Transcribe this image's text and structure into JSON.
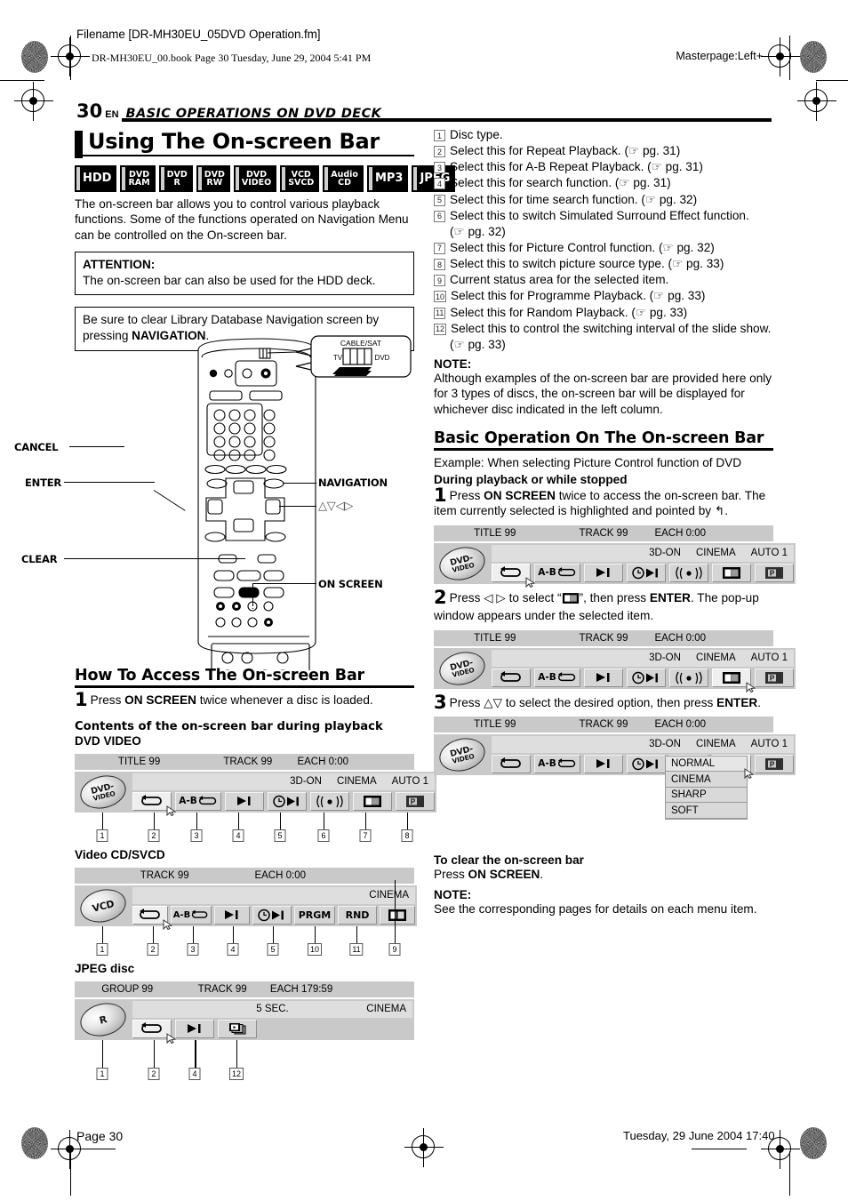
{
  "header": {
    "filename": "Filename [DR-MH30EU_05DVD Operation.fm]",
    "bookline": "DR-MH30EU_00.book  Page 30  Tuesday, June 29, 2004  5:41 PM",
    "masterpage": "Masterpage:Left+"
  },
  "runhead": {
    "page_number": "30",
    "lang": "EN",
    "section": "BASIC OPERATIONS ON DVD DECK"
  },
  "left": {
    "title": "Using The On-screen Bar",
    "badges": [
      {
        "name": "hdd-badge",
        "l1": "HDD",
        "l2": "",
        "single": true
      },
      {
        "name": "dvd-ram-badge",
        "l1": "DVD",
        "l2": "RAM",
        "single": false
      },
      {
        "name": "dvd-r-badge",
        "l1": "DVD",
        "l2": "R",
        "single": false
      },
      {
        "name": "dvd-rw-badge",
        "l1": "DVD",
        "l2": "RW",
        "single": false
      },
      {
        "name": "dvd-video-badge",
        "l1": "DVD",
        "l2": "VIDEO",
        "single": false
      },
      {
        "name": "vcd-svcd-badge",
        "l1": "VCD",
        "l2": "SVCD",
        "single": false
      },
      {
        "name": "audio-cd-badge",
        "l1": "Audio",
        "l2": "CD",
        "single": false
      },
      {
        "name": "mp3-badge",
        "l1": "MP3",
        "l2": "",
        "single": true
      },
      {
        "name": "jpeg-badge",
        "l1": "JPEG",
        "l2": "",
        "single": true
      }
    ],
    "intro": "The on-screen bar allows you to control various playback functions. Some of the functions operated on Navigation Menu can be controlled on the On-screen bar.",
    "attention_label": "ATTENTION:",
    "attention_text": "The on-screen bar can also be used for the HDD deck.",
    "navnote_pre": "Be sure to clear Library Database Navigation screen by pressing ",
    "navnote_bold": "NAVIGATION",
    "navnote_post": ".",
    "remote_labels": {
      "cancel": "CANCEL",
      "enter": "ENTER",
      "clear": "CLEAR",
      "navigation": "NAVIGATION",
      "arrows": "△▽◁▷",
      "on_screen": "ON SCREEN",
      "cable_sat": "CABLE/SAT",
      "tv": "TV",
      "dvd": "DVD"
    },
    "howto_title": "How To Access The On-screen Bar",
    "howto_step1_no": "1",
    "howto_step1_pre": "Press ",
    "howto_step1_bold": "ON SCREEN",
    "howto_step1_post": " twice whenever a disc is loaded.",
    "contents_heading": "Contents of the on-screen bar during playback",
    "dvd_video_heading": "DVD VIDEO",
    "vcd_heading": "Video CD/SVCD",
    "jpeg_heading": "JPEG disc"
  },
  "osb_dvd_video": {
    "disc_l1": "DVD-",
    "disc_l2": "VIDEO",
    "top": [
      "TITLE 99",
      "TRACK 99",
      "EACH 0:00"
    ],
    "status": [
      "3D-ON",
      "CINEMA",
      "AUTO 1"
    ],
    "icons": [
      "repeat",
      "ab-repeat",
      "search",
      "time-search",
      "surround",
      "picture-control",
      "source-type"
    ],
    "ab_label": "A-B",
    "callouts": [
      "1",
      "2",
      "3",
      "4",
      "5",
      "6",
      "7",
      "8"
    ]
  },
  "osb_vcd": {
    "disc_l1": "VCD",
    "top": [
      "TRACK 99",
      "EACH 0:00"
    ],
    "status": [
      "CINEMA"
    ],
    "prgm_label": "PRGM",
    "rnd_label": "RND",
    "ab_label": "A-B",
    "callouts": [
      "1",
      "2",
      "3",
      "4",
      "5",
      "10",
      "11",
      "9"
    ]
  },
  "osb_jpeg": {
    "disc_l1": "R",
    "top": [
      "GROUP 99",
      "TRACK 99",
      "EACH 179:59"
    ],
    "status_center": "5 SEC.",
    "status_right": "CINEMA",
    "callouts": [
      "1",
      "2",
      "4",
      "12"
    ]
  },
  "right": {
    "items": [
      {
        "n": "1",
        "text": "Disc type.",
        "cont": ""
      },
      {
        "n": "2",
        "text": "Select this for Repeat Playback. (☞ pg. 31)",
        "cont": ""
      },
      {
        "n": "3",
        "text": "Select this for A-B Repeat Playback. (☞ pg. 31)",
        "cont": ""
      },
      {
        "n": "4",
        "text": "Select this for search function. (☞ pg. 31)",
        "cont": ""
      },
      {
        "n": "5",
        "text": "Select this for time search function. (☞ pg. 32)",
        "cont": ""
      },
      {
        "n": "6",
        "text": "Select this to switch Simulated Surround Effect function.",
        "cont": "(☞ pg. 32)"
      },
      {
        "n": "7",
        "text": "Select this for Picture Control function. (☞ pg. 32)",
        "cont": ""
      },
      {
        "n": "8",
        "text": "Select this to switch picture source type. (☞ pg. 33)",
        "cont": ""
      },
      {
        "n": "9",
        "text": "Current status area for the selected item.",
        "cont": ""
      },
      {
        "n": "10",
        "text": "Select this for Programme Playback. (☞ pg. 33)",
        "cont": ""
      },
      {
        "n": "11",
        "text": "Select this for Random Playback. (☞ pg. 33)",
        "cont": ""
      },
      {
        "n": "12",
        "text": "Select this to control the switching interval of the slide show.",
        "cont": "(☞ pg. 33)"
      }
    ],
    "note_label": "NOTE:",
    "note_text": "Although examples of the on-screen bar are provided here only for 3 types of discs, the on-screen bar will be displayed for whichever disc indicated in the left column.",
    "basic_title": "Basic Operation On The On-screen Bar",
    "example": "Example: When selecting Picture Control function of DVD",
    "during": "During playback or while stopped",
    "step1_no": "1",
    "step1_a": "Press ",
    "step1_b": "ON SCREEN",
    "step1_c": " twice to access the on-screen bar. The item currently selected is highlighted and pointed by ",
    "step1_d": "↰",
    "step1_e": ".",
    "step2_no": "2",
    "step2_a": "Press ◁ ▷ to select “",
    "step2_b": "”, then press ",
    "step2_c": "ENTER",
    "step2_d": ". The pop-up window appears under the selected item.",
    "step3_no": "3",
    "step3_a": "Press △▽ to select the desired option, then press ",
    "step3_b": "ENTER",
    "step3_c": ".",
    "popup_options": [
      "NORMAL",
      "CINEMA",
      "SHARP",
      "SOFT"
    ],
    "clear_heading": "To clear the on-screen bar",
    "clear_a": "Press ",
    "clear_b": "ON SCREEN",
    "clear_c": ".",
    "note2_label": "NOTE:",
    "note2_text": "See the corresponding pages for details on each menu item."
  },
  "footer": {
    "left": "Page 30",
    "right": "Tuesday, 29 June 2004  17:40"
  }
}
